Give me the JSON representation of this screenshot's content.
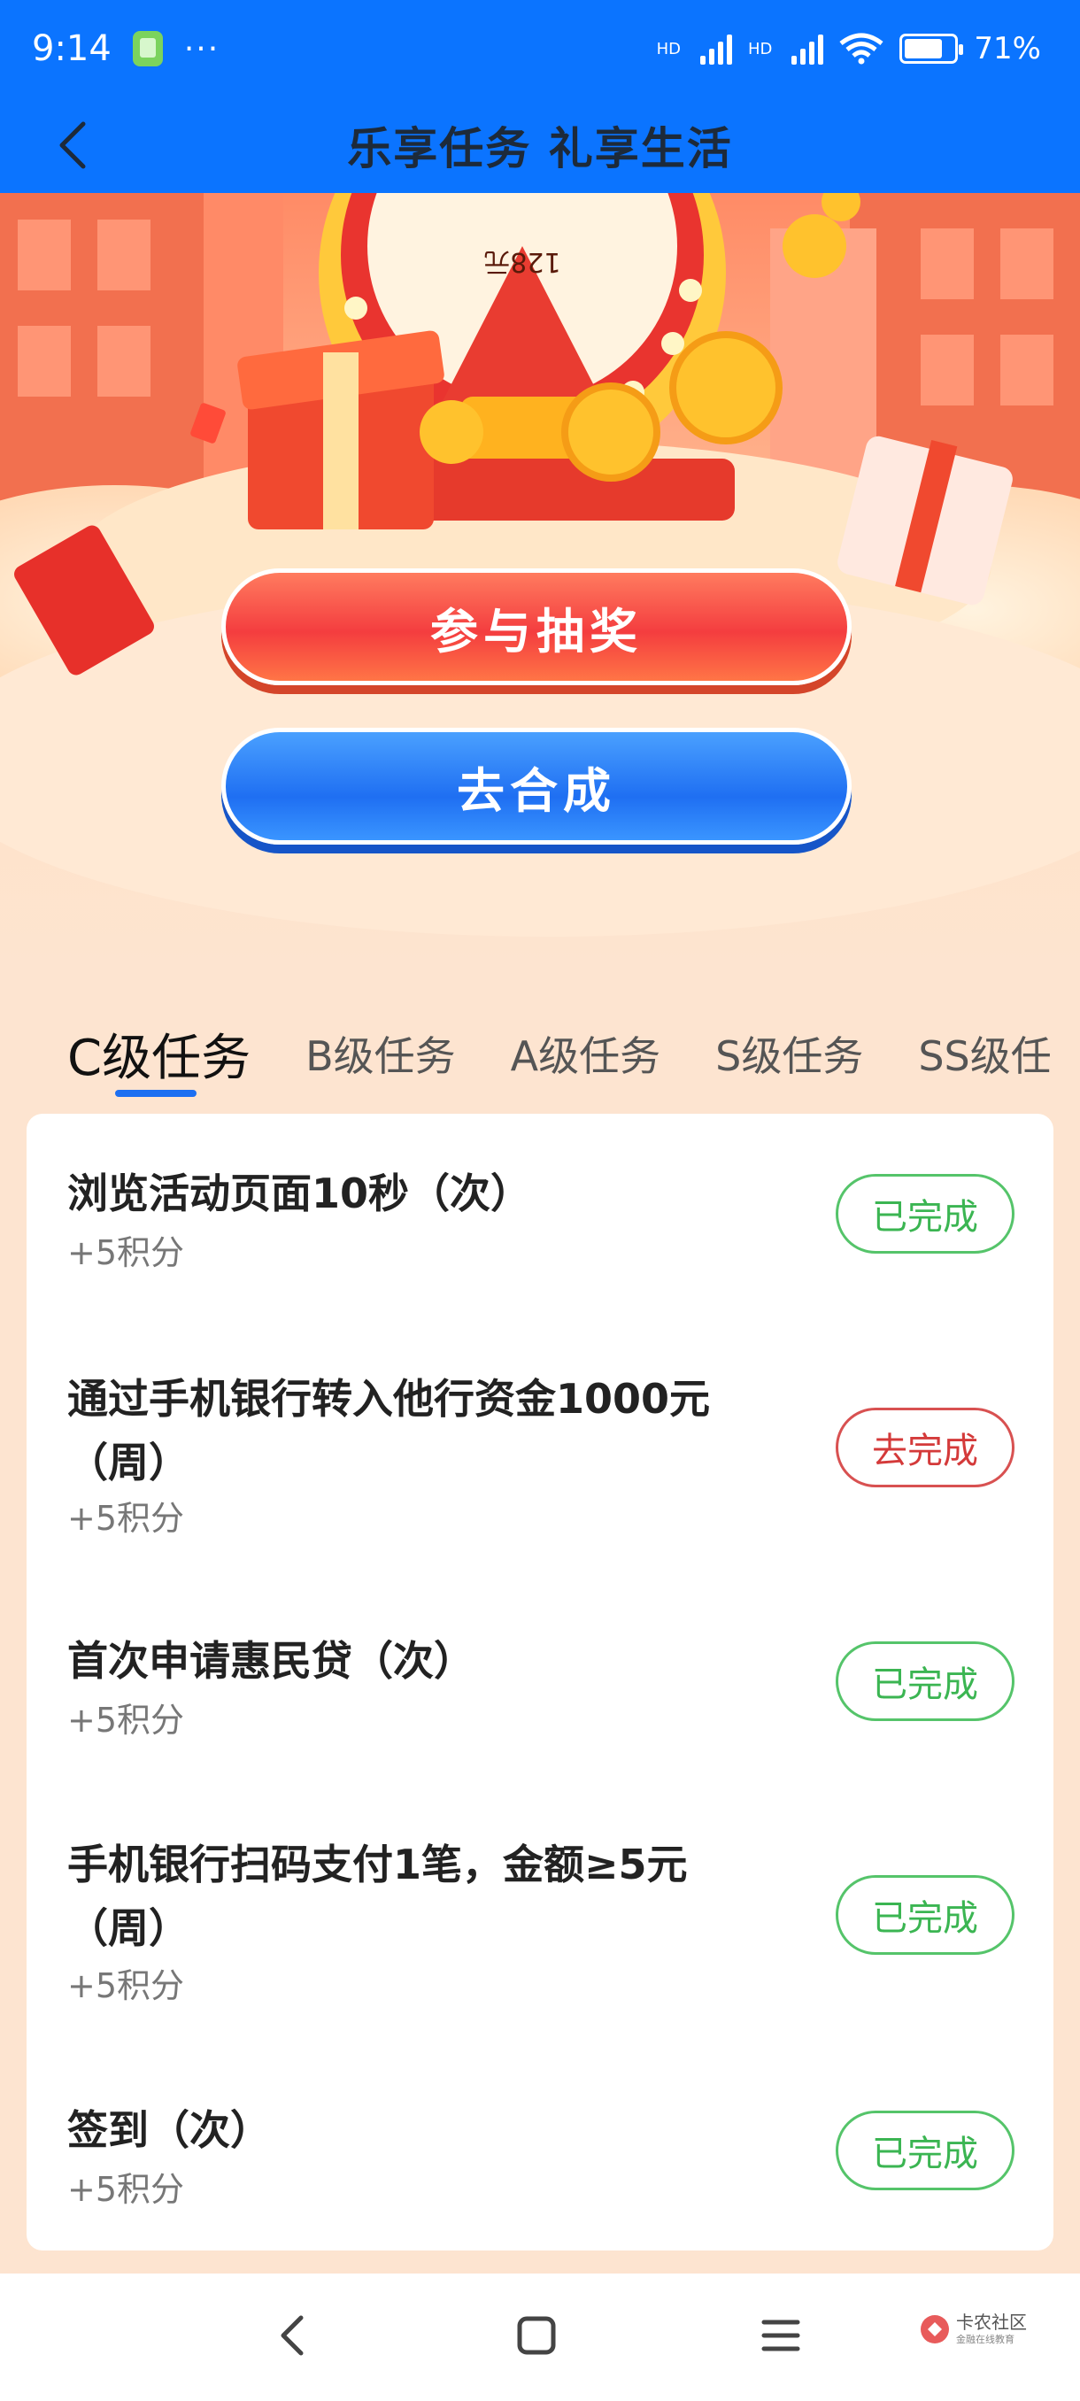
{
  "status": {
    "time": "9:14",
    "hd1": "HD",
    "hd2": "HD",
    "battery": "71%"
  },
  "header": {
    "title": "乐享任务 礼享生活"
  },
  "banner": {
    "prize_text": "128元",
    "draw_button": "参与抽奖",
    "combine_button": "去合成"
  },
  "tabs": [
    {
      "label": "C级任务",
      "active": true
    },
    {
      "label": "B级任务",
      "active": false
    },
    {
      "label": "A级任务",
      "active": false
    },
    {
      "label": "S级任务",
      "active": false
    },
    {
      "label": "SS级任",
      "active": false
    }
  ],
  "tasks": [
    {
      "title": "浏览活动页面10秒（次）",
      "points": "+5积分",
      "button": "已完成",
      "state": "done"
    },
    {
      "title": "通过手机银行转入他行资金1000元（周）",
      "points": "+5积分",
      "button": "去完成",
      "state": "todo"
    },
    {
      "title": "首次申请惠民贷（次）",
      "points": "+5积分",
      "button": "已完成",
      "state": "done"
    },
    {
      "title": "手机银行扫码支付1笔，金额≥5元（周）",
      "points": "+5积分",
      "button": "已完成",
      "state": "done"
    },
    {
      "title": "签到（次）",
      "points": "+5积分",
      "button": "已完成",
      "state": "done"
    }
  ],
  "watermark": {
    "title": "卡农社区",
    "subtitle": "金融在线教育"
  },
  "colors": {
    "header_blue": "#0b74ff",
    "draw_red": "#f43d3f",
    "combine_blue": "#1f6ff2",
    "done_green": "#3bb552",
    "todo_red": "#d43a3a"
  }
}
